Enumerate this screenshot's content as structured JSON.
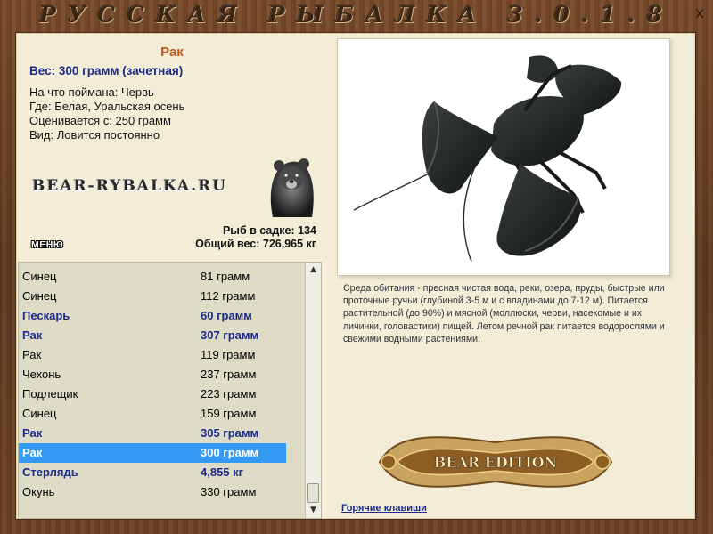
{
  "window": {
    "title": "РУССКАЯ РЫБАЛКА 3.0.1.8",
    "close_label": "x"
  },
  "fish": {
    "name": "Рак",
    "weight_line": "Вес: 300 грамм (зачетная)",
    "details": [
      "На что поймана: Червь",
      "Где: Белая, Уральская осень",
      "Оценивается с: 250 грамм",
      "Вид: Ловится постоянно"
    ]
  },
  "logo": {
    "text": "BEAR-RYBALKA.RU",
    "icon": "bear-icon"
  },
  "stats": {
    "count_line": "Рыб в садке: 134",
    "total_line": "Общий вес: 726,965 кг"
  },
  "menu_label": "МЕНЮ",
  "catch_list": {
    "rows": [
      {
        "name": "Синец",
        "weight": "81 грамм",
        "highlight": false,
        "selected": false
      },
      {
        "name": "Синец",
        "weight": "112 грамм",
        "highlight": false,
        "selected": false
      },
      {
        "name": "Пескарь",
        "weight": "60 грамм",
        "highlight": true,
        "selected": false
      },
      {
        "name": "Рак",
        "weight": "307 грамм",
        "highlight": true,
        "selected": false
      },
      {
        "name": "Рак",
        "weight": "119 грамм",
        "highlight": false,
        "selected": false
      },
      {
        "name": "Чехонь",
        "weight": "237 грамм",
        "highlight": false,
        "selected": false
      },
      {
        "name": "Подлещик",
        "weight": "223 грамм",
        "highlight": false,
        "selected": false
      },
      {
        "name": "Синец",
        "weight": "159 грамм",
        "highlight": false,
        "selected": false
      },
      {
        "name": "Рак",
        "weight": "305 грамм",
        "highlight": true,
        "selected": false
      },
      {
        "name": "Рак",
        "weight": "300 грамм",
        "highlight": true,
        "selected": true
      },
      {
        "name": "Стерлядь",
        "weight": "4,855 кг",
        "highlight": true,
        "selected": false
      },
      {
        "name": "Окунь",
        "weight": "330 грамм",
        "highlight": false,
        "selected": false
      }
    ]
  },
  "photo": {
    "subject": "crayfish-image"
  },
  "habitat_text": "Среда обитания - пресная чистая вода, реки, озера, пруды, быстрые или проточные ручьи (глубиной 3-5 м и с впадинами до 7-12 м). Питается растительной (до 90%) и мясной (моллюски, черви, насекомые и их личинки, головастики) пищей. Летом речной рак питается водорослями и свежими водными растениями.",
  "badge": {
    "text": "BEAR EDITION"
  },
  "hotkeys_label": "Горячие клавиши",
  "colors": {
    "accent_orange": "#c2581b",
    "accent_blue": "#1a2b8a",
    "selection": "#3399f3",
    "panel_bg": "#f3edd8",
    "frame_wood": "#6d4226"
  }
}
